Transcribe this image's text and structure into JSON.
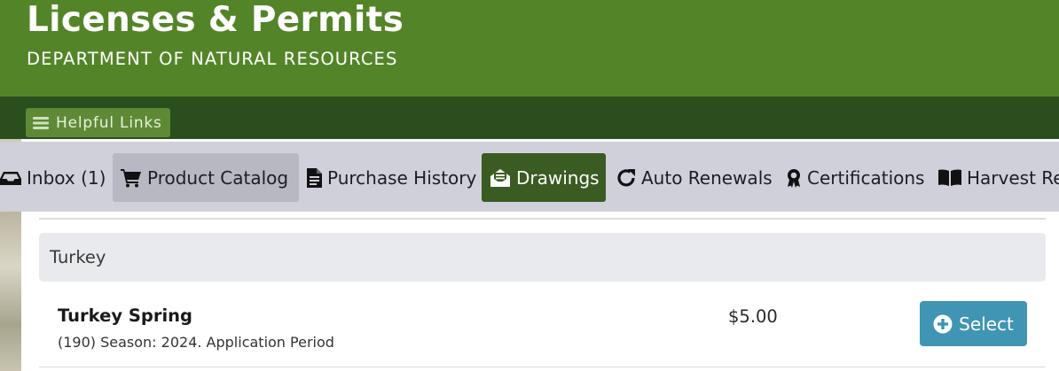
{
  "header": {
    "title": "Licenses & Permits",
    "subtitle": "DEPARTMENT OF NATURAL RESOURCES"
  },
  "linkbar": {
    "helpful_links_label": "Helpful Links",
    "helpful_links_icon": "menu-icon"
  },
  "nav": {
    "items": [
      {
        "label": "Inbox (1)",
        "icon": "inbox-icon",
        "active": false
      },
      {
        "label": "Product Catalog",
        "icon": "cart-icon",
        "active": true
      },
      {
        "label": "Purchase History",
        "icon": "receipt-icon",
        "active": false
      },
      {
        "label": "Drawings",
        "icon": "envelope-open-icon",
        "active": true
      },
      {
        "label": "Auto Renewals",
        "icon": "redo-icon",
        "active": false
      },
      {
        "label": "Certifications",
        "icon": "award-icon",
        "active": false
      },
      {
        "label": "Harvest Re",
        "icon": "book-icon",
        "active": false
      }
    ]
  },
  "catalog": {
    "category": "Turkey",
    "products": [
      {
        "name": "Turkey Spring",
        "description": "(190) Season: 2024. Application Period",
        "price": "$5.00",
        "button_label": "Select",
        "button_icon": "plus-circle-icon"
      }
    ]
  },
  "colors": {
    "banner": "#538528",
    "linkbar": "#2b4e1f",
    "nav_bg": "#d0d0da",
    "drawings_active": "#3a5b22",
    "select_button": "#4095b4"
  }
}
